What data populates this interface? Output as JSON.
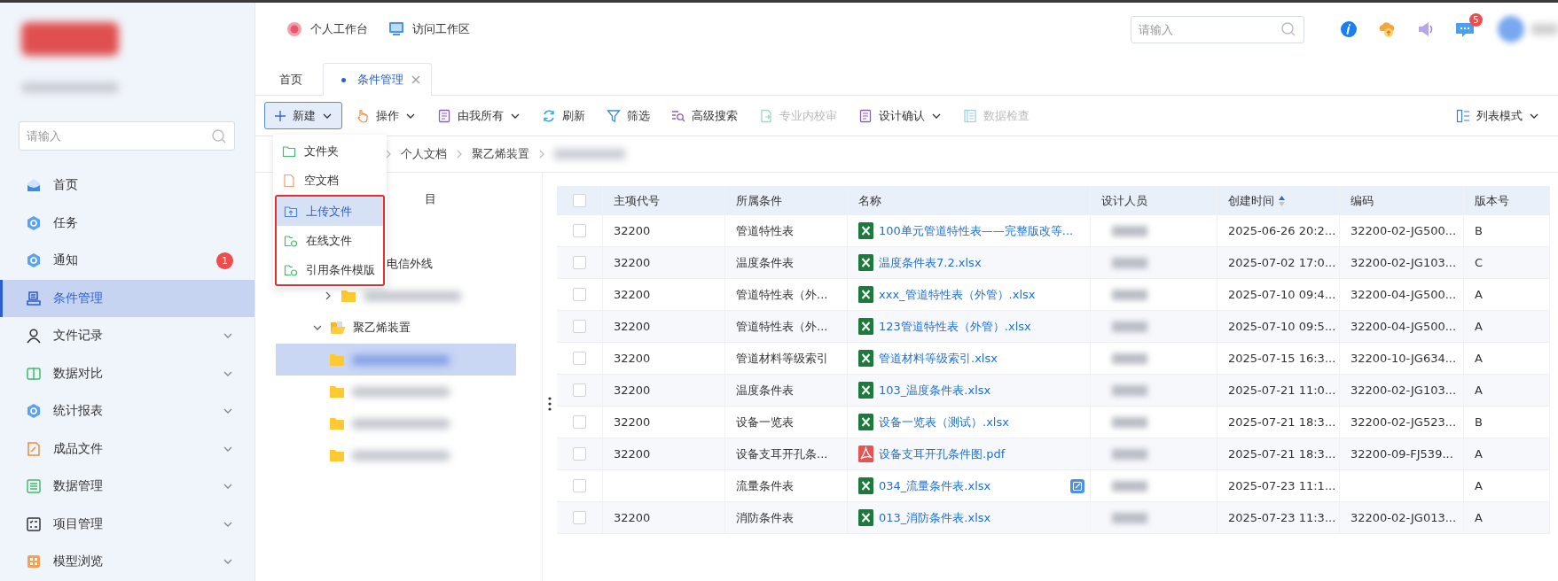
{
  "sidebar": {
    "search": {
      "placeholder": "请输入"
    },
    "items": [
      {
        "label": "首页",
        "selected": false,
        "expandable": false
      },
      {
        "label": "任务",
        "selected": false,
        "expandable": false
      },
      {
        "label": "通知",
        "selected": false,
        "expandable": false,
        "badge": "1"
      },
      {
        "label": "条件管理",
        "selected": true,
        "expandable": false
      },
      {
        "label": "文件记录",
        "selected": false,
        "expandable": true
      },
      {
        "label": "数据对比",
        "selected": false,
        "expandable": true
      },
      {
        "label": "统计报表",
        "selected": false,
        "expandable": true
      },
      {
        "label": "成品文件",
        "selected": false,
        "expandable": true
      },
      {
        "label": "数据管理",
        "selected": false,
        "expandable": true
      },
      {
        "label": "项目管理",
        "selected": false,
        "expandable": true
      },
      {
        "label": "模型浏览",
        "selected": false,
        "expandable": true
      }
    ]
  },
  "topbar": {
    "links": [
      {
        "label": "个人工作台"
      },
      {
        "label": "访问工作区"
      }
    ],
    "search": {
      "placeholder": "请输入"
    },
    "message_badge": "5"
  },
  "tabs": [
    {
      "label": "首页",
      "selected": false,
      "closable": false
    },
    {
      "label": "条件管理",
      "selected": true,
      "closable": true
    }
  ],
  "toolbar": {
    "items": [
      {
        "label": "新建",
        "kind": "primary",
        "dropdown": true,
        "disabled": false
      },
      {
        "label": "操作",
        "kind": "plain",
        "dropdown": true,
        "disabled": false
      },
      {
        "label": "由我所有",
        "kind": "plain",
        "dropdown": true,
        "disabled": false
      },
      {
        "label": "刷新",
        "kind": "plain",
        "dropdown": false,
        "disabled": false
      },
      {
        "label": "筛选",
        "kind": "plain",
        "dropdown": false,
        "disabled": false
      },
      {
        "label": "高级搜索",
        "kind": "plain",
        "dropdown": false,
        "disabled": false
      },
      {
        "label": "专业内校审",
        "kind": "plain",
        "dropdown": false,
        "disabled": true
      },
      {
        "label": "设计确认",
        "kind": "plain",
        "dropdown": true,
        "disabled": false
      },
      {
        "label": "数据检查",
        "kind": "plain",
        "dropdown": false,
        "disabled": true
      }
    ],
    "view_mode": {
      "label": "列表模式"
    }
  },
  "new_menu": {
    "sections": [
      {
        "outlined": false,
        "items": [
          {
            "label": "文件夹",
            "selected": false
          },
          {
            "label": "空文档",
            "selected": false
          }
        ]
      },
      {
        "outlined": true,
        "items": [
          {
            "label": "上传文件",
            "selected": true
          },
          {
            "label": "在线文件",
            "selected": false
          },
          {
            "label": "引用条件模版",
            "selected": false
          }
        ]
      }
    ]
  },
  "breadcrumb": [
    "个人文档",
    "聚乙烯装置"
  ],
  "tree": [
    {
      "label": "目"
    },
    {
      "label": "电信外线"
    },
    {
      "expanded": false
    },
    {
      "label": "聚乙烯装置",
      "expanded": true,
      "children": [
        {
          "selected": true
        },
        {
          "selected": false
        },
        {
          "selected": false
        },
        {
          "selected": false
        }
      ]
    }
  ],
  "table": {
    "all_checked": false,
    "columns": [
      {
        "label": "主项代号"
      },
      {
        "label": "所属条件"
      },
      {
        "label": "名称"
      },
      {
        "label": "设计人员"
      },
      {
        "label": "创建时间",
        "sort_ascending": true
      },
      {
        "label": "编码"
      },
      {
        "label": "版本号"
      }
    ],
    "rows": [
      {
        "checked": false,
        "code": "32200",
        "condition": "管道特性表",
        "name": "100单元管道特性表——完整版改等...",
        "kind": "xlsx",
        "created": "2025-06-26 20:2...",
        "serial": "32200-02-JG500...",
        "version": "B"
      },
      {
        "checked": false,
        "code": "32200",
        "condition": "温度条件表",
        "name": "温度条件表7.2.xlsx",
        "kind": "xlsx",
        "created": "2025-07-02 17:0...",
        "serial": "32200-02-JG103...",
        "version": "C"
      },
      {
        "checked": false,
        "code": "32200",
        "condition": "管道特性表（外...",
        "name": "xxx_管道特性表（外管）.xlsx",
        "kind": "xlsx",
        "created": "2025-07-10 09:4...",
        "serial": "32200-04-JG500...",
        "version": "A"
      },
      {
        "checked": false,
        "code": "32200",
        "condition": "管道特性表（外...",
        "name": "123管道特性表（外管）.xlsx",
        "kind": "xlsx",
        "created": "2025-07-10 09:5...",
        "serial": "32200-04-JG500...",
        "version": "A"
      },
      {
        "checked": false,
        "code": "32200",
        "condition": "管道材料等级索引",
        "name": "管道材料等级索引.xlsx",
        "kind": "xlsx",
        "created": "2025-07-15 16:3...",
        "serial": "32200-10-JG634...",
        "version": "A"
      },
      {
        "checked": false,
        "code": "32200",
        "condition": "温度条件表",
        "name": "103_温度条件表.xlsx",
        "kind": "xlsx",
        "created": "2025-07-21 11:0...",
        "serial": "32200-02-JG103...",
        "version": "A"
      },
      {
        "checked": false,
        "code": "32200",
        "condition": "设备一览表",
        "name": "设备一览表（测试）.xlsx",
        "kind": "xlsx",
        "created": "2025-07-21 18:3...",
        "serial": "32200-02-JG523...",
        "version": "B"
      },
      {
        "checked": false,
        "code": "32200",
        "condition": "设备支耳开孔条...",
        "name": "设备支耳开孔条件图.pdf",
        "kind": "pdf",
        "created": "2025-07-21 18:3...",
        "serial": "32200-09-FJ539...",
        "version": "A"
      },
      {
        "checked": false,
        "condition": "流量条件表",
        "name": "034_流量条件表.xlsx",
        "kind": "xlsx",
        "note": true,
        "created": "2025-07-23 11:1...",
        "version": "A"
      },
      {
        "checked": false,
        "code": "32200",
        "condition": "消防条件表",
        "name": "013_消防条件表.xlsx",
        "kind": "xlsx",
        "created": "2025-07-23 11:3...",
        "serial": "32200-02-JG013...",
        "version": "A"
      }
    ]
  }
}
